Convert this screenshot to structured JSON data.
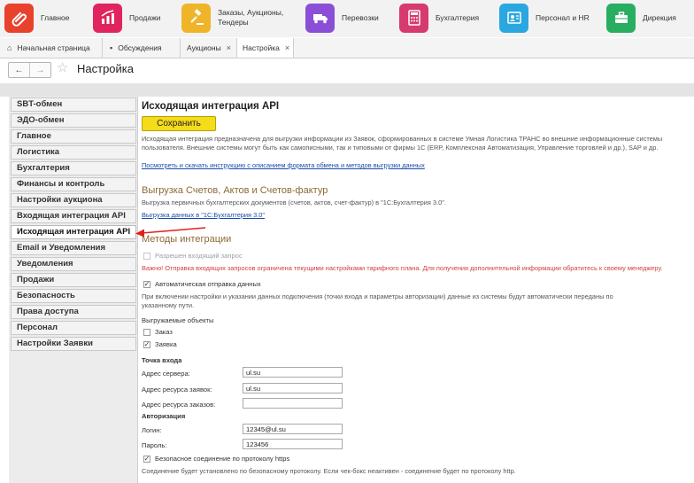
{
  "modules": [
    {
      "label": "Главное",
      "icon": "clip-icon",
      "color": "#e8412c"
    },
    {
      "label": "Продажи",
      "icon": "chart-icon",
      "color": "#e0245e"
    },
    {
      "label": "Заказы, Аукционы, Тендеры",
      "icon": "gavel-icon",
      "color": "#f0b429"
    },
    {
      "label": "Перевозки",
      "icon": "truck-icon",
      "color": "#8a4fd6"
    },
    {
      "label": "Бухгалтерия",
      "icon": "calculator-icon",
      "color": "#d63a6e"
    },
    {
      "label": "Персонал и HR",
      "icon": "badge-icon",
      "color": "#2aa7e0"
    },
    {
      "label": "Дирекция",
      "icon": "briefcase-icon",
      "color": "#27ae60"
    }
  ],
  "tabs": [
    {
      "label": "Начальная страница",
      "icon": "home-icon"
    },
    {
      "label": "Обсуждения",
      "icon": "chat-icon"
    },
    {
      "label": "Аукционы",
      "close": "×"
    },
    {
      "label": "Настройка",
      "close": "×"
    }
  ],
  "nav": {
    "back": "←",
    "forward": "→",
    "star": "☆"
  },
  "page_title": "Настройка",
  "sidebar": {
    "items": [
      "SBT-обмен",
      "ЭДО-обмен",
      "Главное",
      "Логистика",
      "Бухгалтерия",
      "Финансы и контроль",
      "Настройки аукциона",
      "Входящая интеграция API",
      "Исходящая интеграция API",
      "Email и Уведомления",
      "Уведомления",
      "Продажи",
      "Безопасность",
      "Права доступа",
      "Персонал",
      "Настройки Заявки"
    ],
    "active_index": 8
  },
  "main": {
    "title": "Исходящая интеграция API",
    "save_label": "Сохранить",
    "description": "Исходящая интеграция предназначена для выгрузки информации из Заявок, сформированных в системе Умная Логистика ТРАНС во внешние информационные системы пользователя. Внешние системы могут быть как самописными, так и типовыми от фирмы 1С (ERP, Комплексная Автоматизация, Управление торговлей и др.), SAP и др.",
    "instruction_link": "Посмотреть и скачать инструкцию с описанием формата обмена и методов выгрузки данных",
    "export_title": "Выгрузка Счетов, Актов и Счетов-фактур",
    "export_description": "Выгрузка первичных бухгалтерских документов (счетов, актов, счет-фактур) в \"1С:Бухгалтерия 3.0\".",
    "export_link": "Выгрузка данных в \"1С:Бухгалтерия 3.0\"",
    "methods_title": "Методы интеграции",
    "incoming_request_label": "Разрешен входящий запрос",
    "warning": "Важно! Отправка входящих запросов ограничена текущими настройками тарифного плана. Для получения дополнительной информации обратитесь к своему менеджеру.",
    "auto_send_label": "Автоматическая отправка данных",
    "auto_send_description": "При включении настройки и указании данных подключения (точки входа и параметры авторизации) данные из системы будут автоматически переданы по указанному пути.",
    "export_objects_label": "Выгружаемые объекты",
    "objects": [
      {
        "label": "Заказ",
        "checked": false
      },
      {
        "label": "Заявка",
        "checked": true
      }
    ],
    "entry_point_title": "Точка входа",
    "server_label": "Адрес сервера:",
    "server_value": "ul.su",
    "requests_label": "Адрес ресурса заявок:",
    "requests_value": "ul.su",
    "orders_label": "Адрес ресурса заказов:",
    "orders_value": "",
    "auth_title": "Авторизация",
    "login_label": "Логин:",
    "login_value": "12345@ul.su",
    "password_label": "Пароль:",
    "password_value": "123456",
    "https_label": "Безопасное соединение по протоколу https",
    "https_note": "Соединение будет установлено по безопасному протоколу. Если чек-бокс неактивен - соединение будет по протоколу http.",
    "checkmark": "✓"
  },
  "annotation_color": "#e02020"
}
